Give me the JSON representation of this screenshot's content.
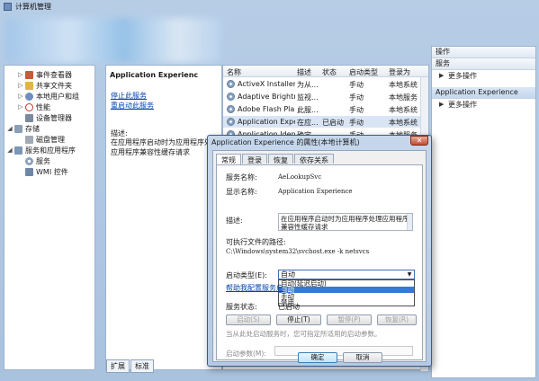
{
  "window": {
    "title": "计算机管理"
  },
  "tree": {
    "items": [
      {
        "label": "事件查看器",
        "expander": "▷"
      },
      {
        "label": "共享文件夹",
        "expander": "▷"
      },
      {
        "label": "本地用户和组",
        "expander": "▷"
      },
      {
        "label": "性能",
        "expander": "▷"
      },
      {
        "label": "设备管理器",
        "expander": ""
      },
      {
        "label": "存储",
        "expander": "◢"
      },
      {
        "label": "磁盘管理",
        "expander": ""
      },
      {
        "label": "服务和应用程序",
        "expander": "◢"
      },
      {
        "label": "服务",
        "expander": ""
      },
      {
        "label": "WMI 控件",
        "expander": ""
      }
    ]
  },
  "description_pane": {
    "title": "Application Experienc",
    "stop_link": "停止此服务",
    "restart_link": "重启动此服务",
    "desc_label": "描述:",
    "desc_text": "在应用程序启动时为应用程序处理应用程序兼容性缓存请求"
  },
  "list": {
    "headers": [
      "名称",
      "描述",
      "状态",
      "启动类型",
      "登录为"
    ],
    "rows": [
      {
        "name": "ActiveX Installer ...",
        "desc": "为从...",
        "status": "",
        "startup": "手动",
        "logon": "本地系统"
      },
      {
        "name": "Adaptive Brightn...",
        "desc": "监视...",
        "status": "",
        "startup": "手动",
        "logon": "本地服务"
      },
      {
        "name": "Adobe Flash Pla...",
        "desc": "此服...",
        "status": "",
        "startup": "手动",
        "logon": "本地系统"
      },
      {
        "name": "Application Expe...",
        "desc": "在应...",
        "status": "已启动",
        "startup": "手动",
        "logon": "本地系统"
      },
      {
        "name": "Application Iden...",
        "desc": "确定...",
        "status": "",
        "startup": "手动",
        "logon": "本地服务"
      }
    ]
  },
  "bottom_tabs": [
    "扩展",
    "标准"
  ],
  "actions": {
    "header": "操作",
    "section1": "服务",
    "section1_more": "更多操作",
    "section2": "Application Experience",
    "section2_more": "更多操作"
  },
  "dialog": {
    "title": "Application Experience 的属性(本地计算机)",
    "close": "✕",
    "tabs": [
      "常规",
      "登录",
      "恢复",
      "依存关系"
    ],
    "service_name_label": "服务名称:",
    "service_name": "AeLookupSvc",
    "display_name_label": "显示名称:",
    "display_name": "Application Experience",
    "description_label": "描述:",
    "description": "在应用程序启动时为应用程序处理应用程序兼容性缓存请求",
    "path_label": "可执行文件的路径:",
    "path": "C:\\Windows\\system32\\svchost.exe -k netsvcs",
    "startup_label": "启动类型(E):",
    "startup_value": "自动",
    "startup_options": [
      "自动(延迟启动)",
      "自动",
      "手动",
      "禁用"
    ],
    "help_link": "帮助我配置服务启",
    "status_label": "服务状态:",
    "status_value": "已启动",
    "buttons": {
      "start": "启动(S)",
      "stop": "停止(T)",
      "pause": "暂停(P)",
      "resume": "恢复(R)"
    },
    "hint": "当从此处启动服务时，您可指定所适用的启动参数。",
    "param_label": "启动参数(M):",
    "ok": "确定",
    "cancel": "取消"
  }
}
